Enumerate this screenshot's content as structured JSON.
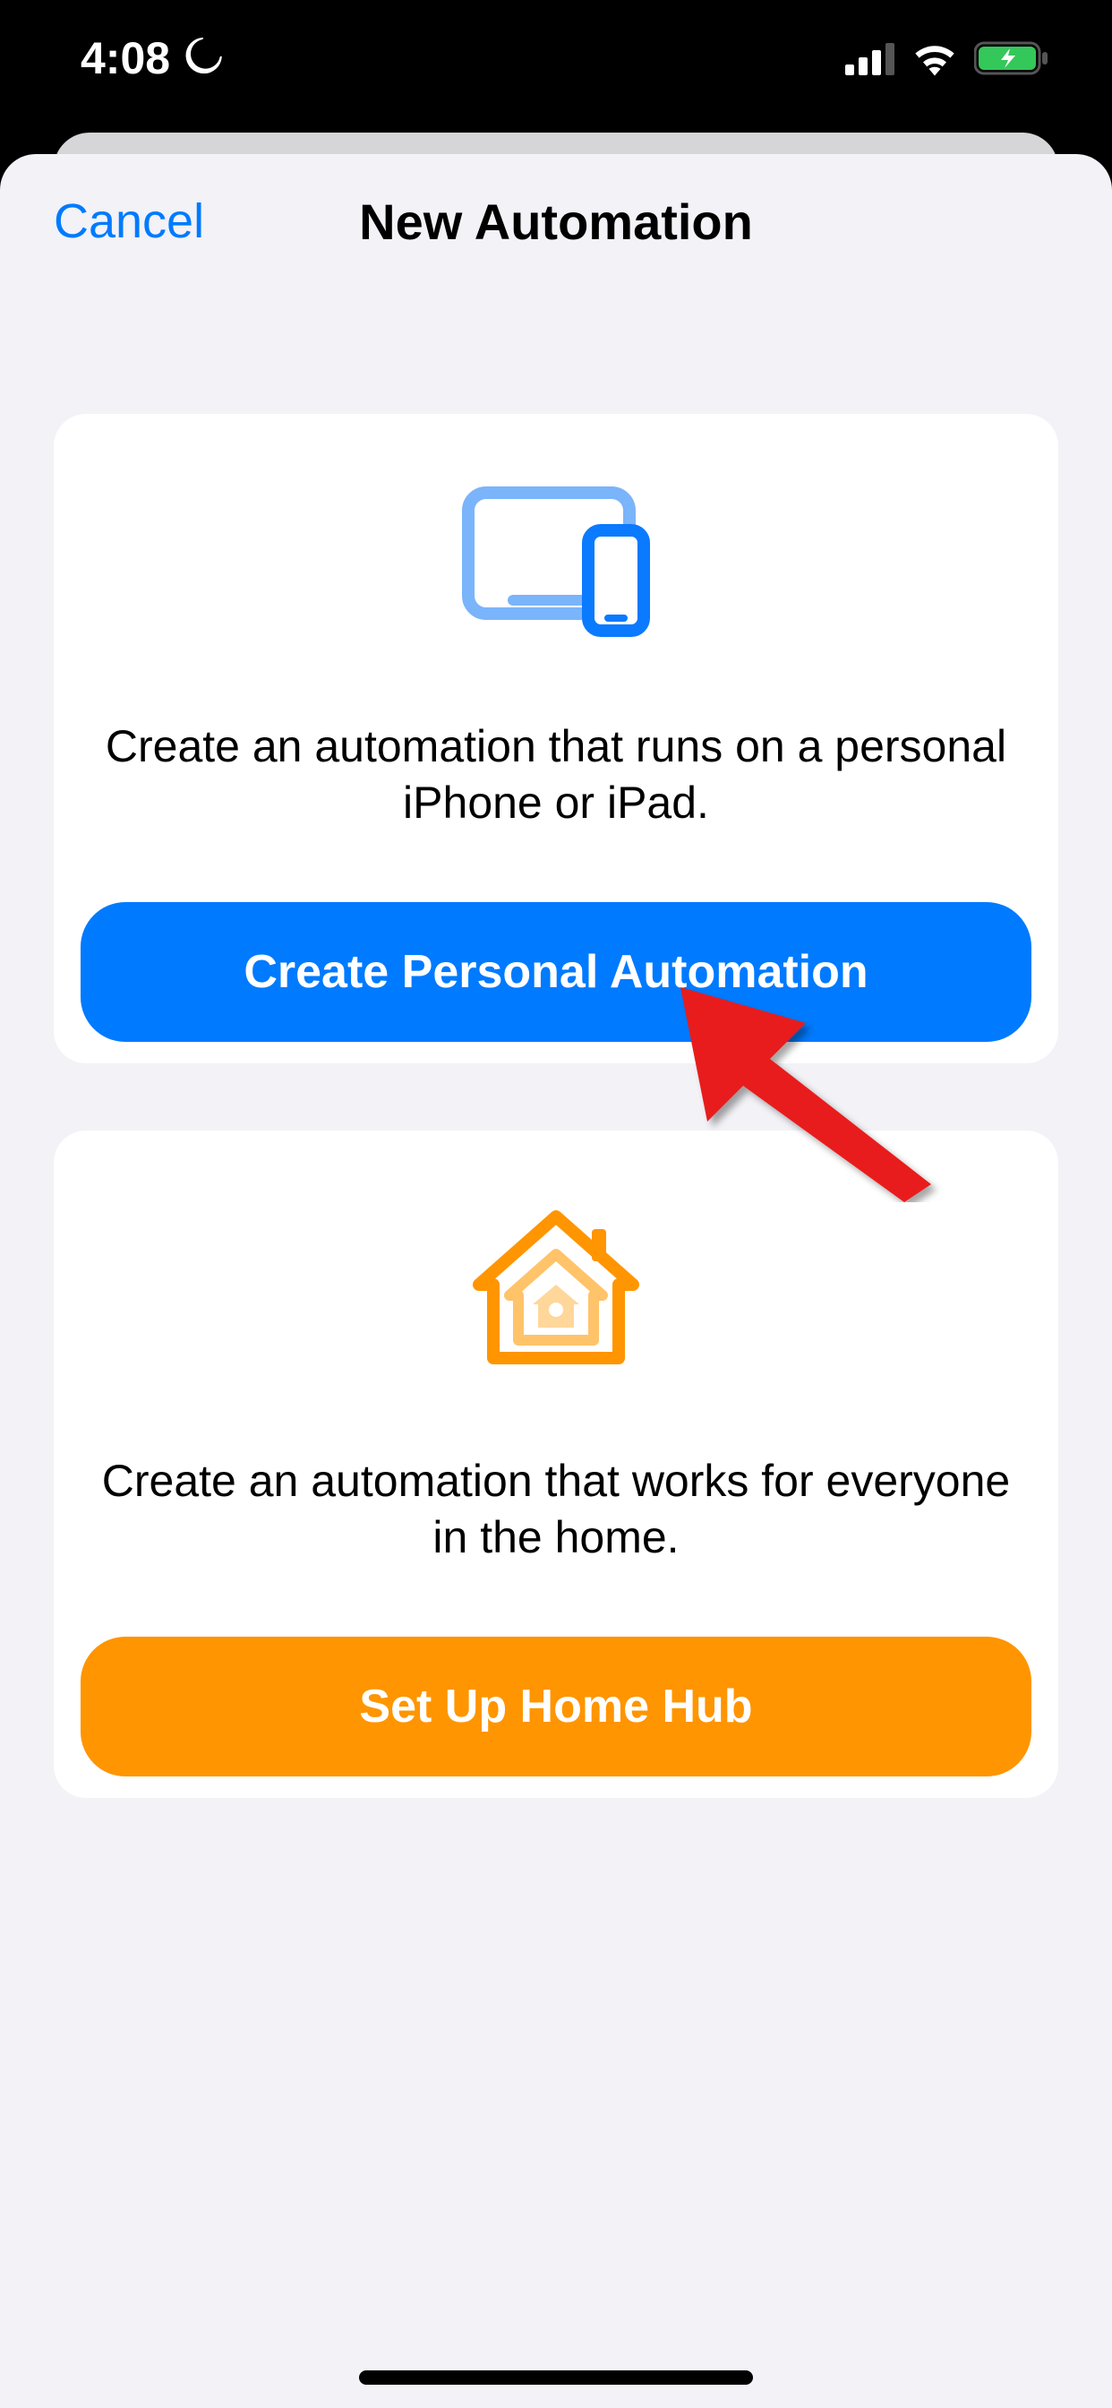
{
  "status": {
    "time": "4:08"
  },
  "sheet": {
    "cancel": "Cancel",
    "title": "New Automation"
  },
  "cards": {
    "personal": {
      "description": "Create an automation that runs on a personal iPhone or iPad.",
      "button": "Create Personal Automation"
    },
    "home": {
      "description": "Create an automation that works for everyone in the home.",
      "button": "Set Up Home Hub"
    }
  }
}
